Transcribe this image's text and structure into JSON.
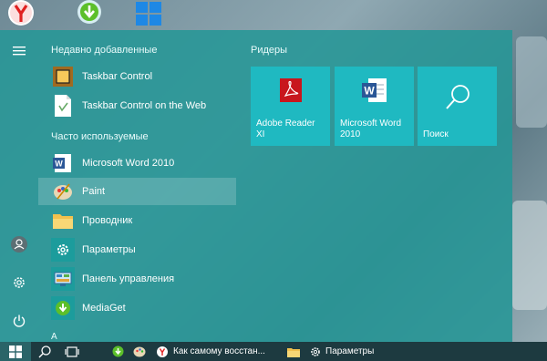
{
  "colors": {
    "start_bg": "#2a9797",
    "tile_bg": "#1fb9c1",
    "taskbar_bg": "#1d3a40",
    "selected_bg": "#5fb3b3"
  },
  "desktop": {
    "icons": [
      "yandex-browser-icon",
      "mediaget-download-icon",
      "windows-icon"
    ]
  },
  "start_menu": {
    "rail": [
      {
        "name": "hamburger-menu-icon"
      },
      {
        "name": "user-avatar-icon"
      },
      {
        "name": "settings-gear-icon"
      },
      {
        "name": "power-icon"
      }
    ],
    "recent_title": "Недавно добавленные",
    "recent": [
      {
        "label": "Taskbar Control",
        "icon": "taskbar-control-icon"
      },
      {
        "label": "Taskbar Control on the Web",
        "icon": "web-document-icon"
      }
    ],
    "frequent_title": "Часто используемые",
    "frequent": [
      {
        "label": "Microsoft Word 2010",
        "icon": "word-icon"
      },
      {
        "label": "Paint",
        "icon": "paint-palette-icon"
      },
      {
        "label": "Проводник",
        "icon": "file-explorer-folder-icon"
      },
      {
        "label": "Параметры",
        "icon": "settings-gear-icon"
      },
      {
        "label": "Панель управления",
        "icon": "control-panel-icon"
      },
      {
        "label": "MediaGet",
        "icon": "mediaget-icon"
      }
    ],
    "more_glyph": "A",
    "group_title": "Ридеры",
    "tiles": [
      {
        "label": "Adobe Reader\nXI",
        "icon": "adobe-reader-icon"
      },
      {
        "label": "Microsoft Word\n2010",
        "icon": "word-icon"
      },
      {
        "label": "Поиск",
        "icon": "search-icon"
      }
    ]
  },
  "taskbar": {
    "tasks": [
      {
        "label": "Как самому восстан...",
        "icon": "yandex-browser-icon"
      },
      {
        "label": "Параметры",
        "icon": "settings-gear-icon"
      }
    ]
  }
}
